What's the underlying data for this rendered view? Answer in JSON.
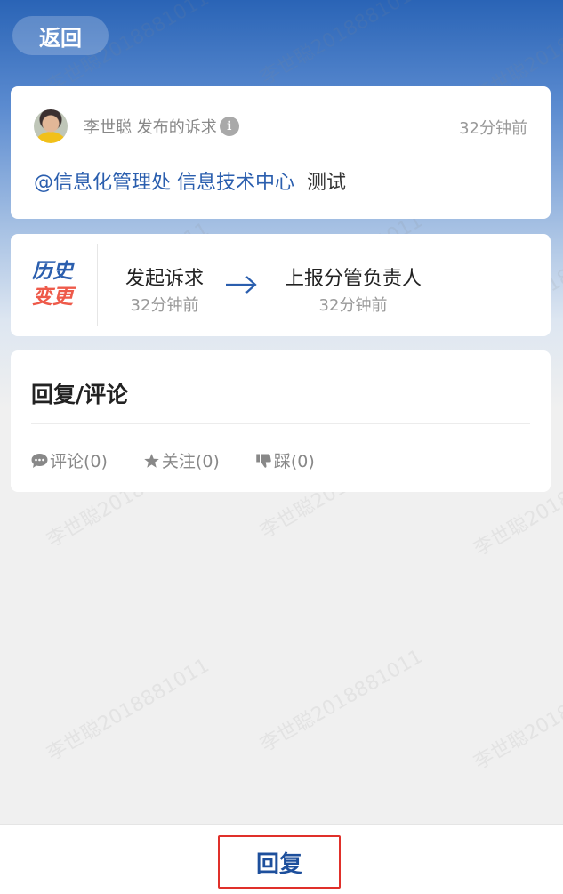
{
  "header": {
    "back_label": "返回"
  },
  "post": {
    "author_meta": "李世聪 发布的诉求",
    "time": "32分钟前",
    "mention": "@信息化管理处 信息技术中心",
    "content": "测试"
  },
  "history": {
    "badge_line1": "历史",
    "badge_line2": "变更",
    "steps": [
      {
        "title": "发起诉求",
        "time": "32分钟前"
      },
      {
        "title": "上报分管负责人",
        "time": "32分钟前"
      }
    ]
  },
  "comments": {
    "title": "回复/评论",
    "actions": [
      {
        "label": "评论(0)",
        "icon": "comment-icon"
      },
      {
        "label": "关注(0)",
        "icon": "star-icon"
      },
      {
        "label": "踩(0)",
        "icon": "thumbs-down-icon"
      }
    ]
  },
  "watermark": "李世聪2018881011",
  "footer": {
    "reply_label": "回复"
  },
  "colors": {
    "accent": "#2a5eae",
    "badge_red": "#ee5a4a",
    "highlight_border": "#e0302a"
  }
}
